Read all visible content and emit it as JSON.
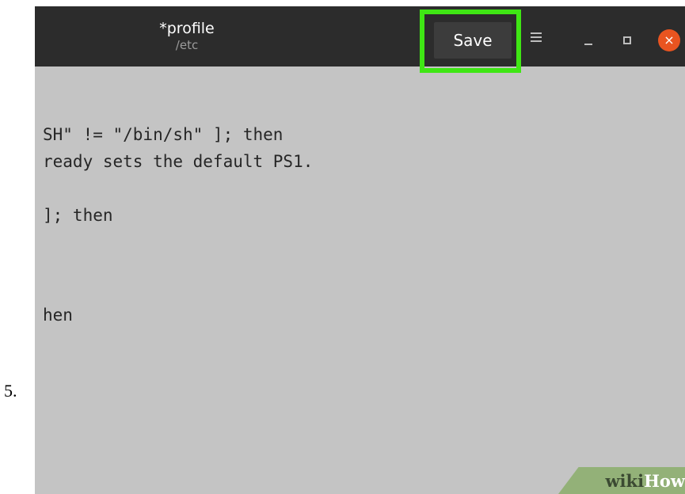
{
  "step": {
    "number": "5."
  },
  "headerbar": {
    "title": "*profile",
    "subtitle": "/etc",
    "save_label": "Save",
    "menu_icon": "hamburger-menu-icon",
    "minimize_icon": "minimize-icon",
    "maximize_icon": "maximize-icon",
    "close_icon": "close-icon",
    "close_glyph": "×"
  },
  "editor": {
    "lines": [
      "SH\" != \"/bin/sh\" ]; then",
      "ready sets the default PS1.",
      "]; then",
      "hen"
    ]
  },
  "watermark": {
    "wiki": "wiki",
    "how": "How"
  },
  "colors": {
    "highlight": "#3fe614",
    "headerbar": "#2c2c2c",
    "editor_bg": "#c4c4c4",
    "close_button": "#e95420"
  }
}
